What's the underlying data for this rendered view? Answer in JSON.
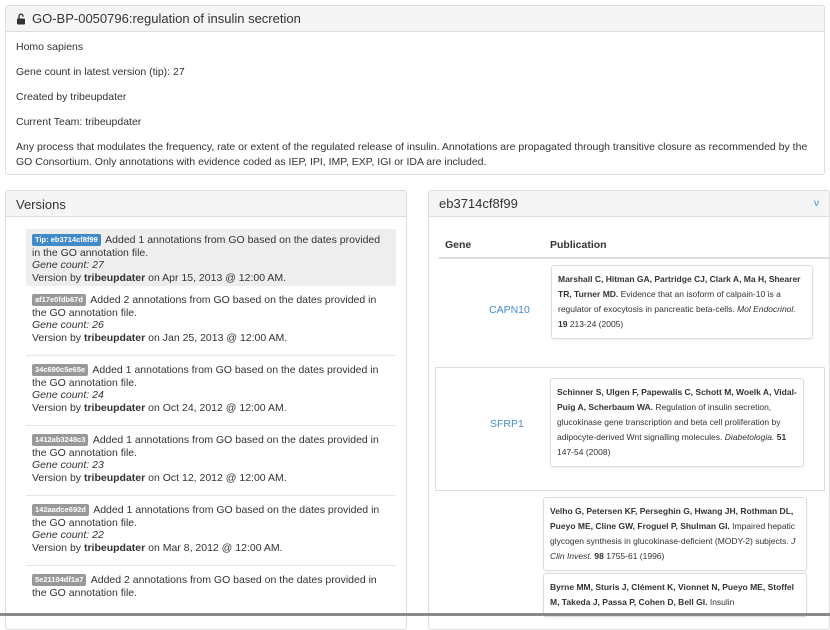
{
  "header": {
    "lock_icon": "unlock-icon",
    "title": "GO-BP-0050796:regulation of insulin secretion"
  },
  "info": {
    "species": "Homo sapiens",
    "gene_count": "Gene count in latest version (tip): 27",
    "created_by": "Created by tribeupdater",
    "current_team": "Current Team: tribeupdater",
    "description": "Any process that modulates the frequency, rate or extent of the regulated release of insulin. Annotations are propagated through transitive closure as recommended by the GO Consortium. Only annotations with evidence coded as IEP, IPI, IMP, EXP, IGI or IDA are included."
  },
  "versions": {
    "title": "Versions",
    "items": [
      {
        "tag": "Tip: eb3714cf8f99",
        "text": "Added 1 annotations from GO based on the dates provided in the GO annotation file.",
        "count": "Gene count: 27",
        "by_prefix": "Version by ",
        "user": "tribeupdater",
        "date": " on Apr 15, 2013 @ 12:00 AM."
      },
      {
        "tag": "af17e0fdb67d",
        "text": "Added 2 annotations from GO based on the dates provided in the GO annotation file.",
        "count": "Gene count: 26",
        "by_prefix": "Version by ",
        "user": "tribeupdater",
        "date": " on Jan 25, 2013 @ 12:00 AM."
      },
      {
        "tag": "34c690c5e65e",
        "text": "Added 1 annotations from GO based on the dates provided in the GO annotation file.",
        "count": "Gene count: 24",
        "by_prefix": "Version by ",
        "user": "tribeupdater",
        "date": " on Oct 24, 2012 @ 12:00 AM."
      },
      {
        "tag": "1412ab3248c3",
        "text": "Added 1 annotations from GO based on the dates provided in the GO annotation file.",
        "count": "Gene count: 23",
        "by_prefix": "Version by ",
        "user": "tribeupdater",
        "date": " on Oct 12, 2012 @ 12:00 AM."
      },
      {
        "tag": "142aadce692d",
        "text": "Added 1 annotations from GO based on the dates provided in the GO annotation file.",
        "count": "Gene count: 22",
        "by_prefix": "Version by ",
        "user": "tribeupdater",
        "date": " on Mar 8, 2012 @ 12:00 AM."
      },
      {
        "tag": "5e21194df1a7",
        "text": "Added 2 annotations from GO based on the dates provided in the GO annotation file.",
        "count": "",
        "by_prefix": "",
        "user": "",
        "date": ""
      }
    ]
  },
  "genes": {
    "title": "eb3714cf8f99",
    "expand_label": "ν",
    "col_gene": "Gene",
    "col_publication": "Publication",
    "rows": [
      {
        "gene": "CAPN10",
        "pubs": [
          {
            "authors": "Marshall C, Hitman GA, Partridge CJ, Clark A, Ma H, Shearer TR, Turner MD.",
            "title": " Evidence that an isoform of calpain-10 is a regulator of exocytosis in pancreatic beta-cells. ",
            "journal": "Mol Endocrinol.",
            "volume": " 19",
            "pages": " 213-24 (2005)"
          }
        ]
      },
      {
        "gene": "SFRP1",
        "pubs": [
          {
            "authors": "Schinner S, Ulgen F, Papewalis C, Schott M, Woelk A, Vidal-Puig A, Scherbaum WA.",
            "title": " Regulation of insulin secretion, glucokinase gene transcription and beta cell proliferation by adipocyte-derived Wnt signalling molecules. ",
            "journal": "Diabetologia.",
            "volume": " 51",
            "pages": " 147-54 (2008)"
          }
        ]
      },
      {
        "gene": "",
        "pubs": [
          {
            "authors": "Velho G, Petersen KF, Perseghin G, Hwang JH, Rothman DL, Pueyo ME, Cline GW, Froguel P, Shulman GI.",
            "title": " Impaired hepatic glycogen synthesis in glucokinase-deficient (MODY-2) subjects. ",
            "journal": "J Clin Invest.",
            "volume": " 98",
            "pages": " 1755-61 (1996)"
          },
          {
            "authors": "Byrne MM, Sturis J, Clément K, Vionnet N, Pueyo ME, Stoffel M, Takeda J, Passa P, Cohen D, Bell GI.",
            "title": " Insulin",
            "journal": "",
            "volume": "",
            "pages": ""
          }
        ]
      }
    ]
  }
}
